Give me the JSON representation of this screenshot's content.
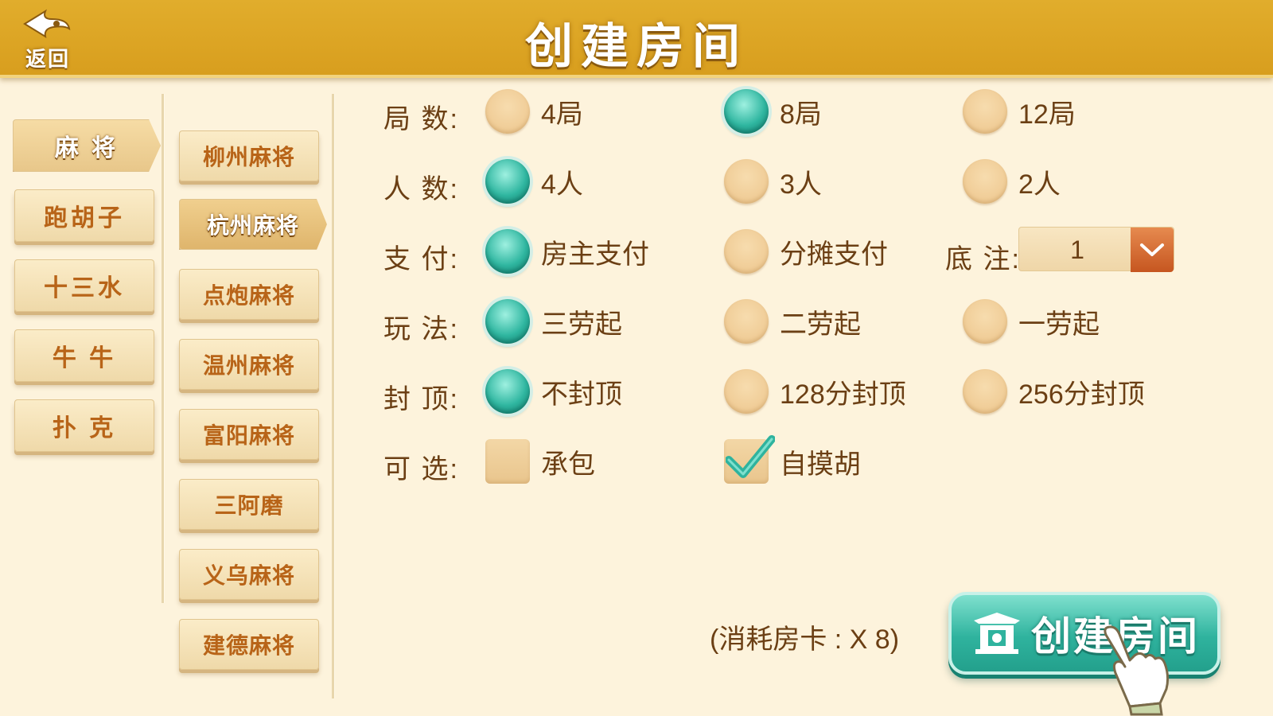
{
  "header": {
    "back_label": "返回",
    "title": "创建房间"
  },
  "categories": [
    {
      "label": "麻 将",
      "active": true
    },
    {
      "label": "跑胡子",
      "active": false
    },
    {
      "label": "十三水",
      "active": false
    },
    {
      "label": "牛 牛",
      "active": false
    },
    {
      "label": "扑 克",
      "active": false
    }
  ],
  "games": [
    {
      "label": "柳州麻将",
      "active": false
    },
    {
      "label": "杭州麻将",
      "active": true
    },
    {
      "label": "点炮麻将",
      "active": false
    },
    {
      "label": "温州麻将",
      "active": false
    },
    {
      "label": "富阳麻将",
      "active": false
    },
    {
      "label": "三阿磨",
      "active": false
    },
    {
      "label": "义乌麻将",
      "active": false
    },
    {
      "label": "建德麻将",
      "active": false
    }
  ],
  "options": {
    "rounds": {
      "label": "局  数:",
      "choices": [
        "4局",
        "8局",
        "12局"
      ],
      "selected": "8局"
    },
    "players": {
      "label": "人  数:",
      "choices": [
        "4人",
        "3人",
        "2人"
      ],
      "selected": "4人"
    },
    "payment": {
      "label": "支  付:",
      "choices": [
        "房主支付",
        "分摊支付"
      ],
      "selected": "房主支付"
    },
    "base_bet": {
      "label": "底  注:",
      "value": "1"
    },
    "play": {
      "label": "玩  法:",
      "choices": [
        "三劳起",
        "二劳起",
        "一劳起"
      ],
      "selected": "三劳起"
    },
    "cap": {
      "label": "封  顶:",
      "choices": [
        "不封顶",
        "128分封顶",
        "256分封顶"
      ],
      "selected": "不封顶"
    },
    "extras": {
      "label": "可  选:",
      "choices": [
        "承包",
        "自摸胡"
      ],
      "checked": [
        "自摸胡"
      ]
    }
  },
  "footer": {
    "cost_text": "(消耗房卡 : X 8)",
    "create_label": "创建房间"
  },
  "colors": {
    "header_gold": "#d89e1e",
    "accent_teal": "#2fb39e",
    "text_brown": "#6b3f14",
    "button_orange_text": "#b86418"
  }
}
